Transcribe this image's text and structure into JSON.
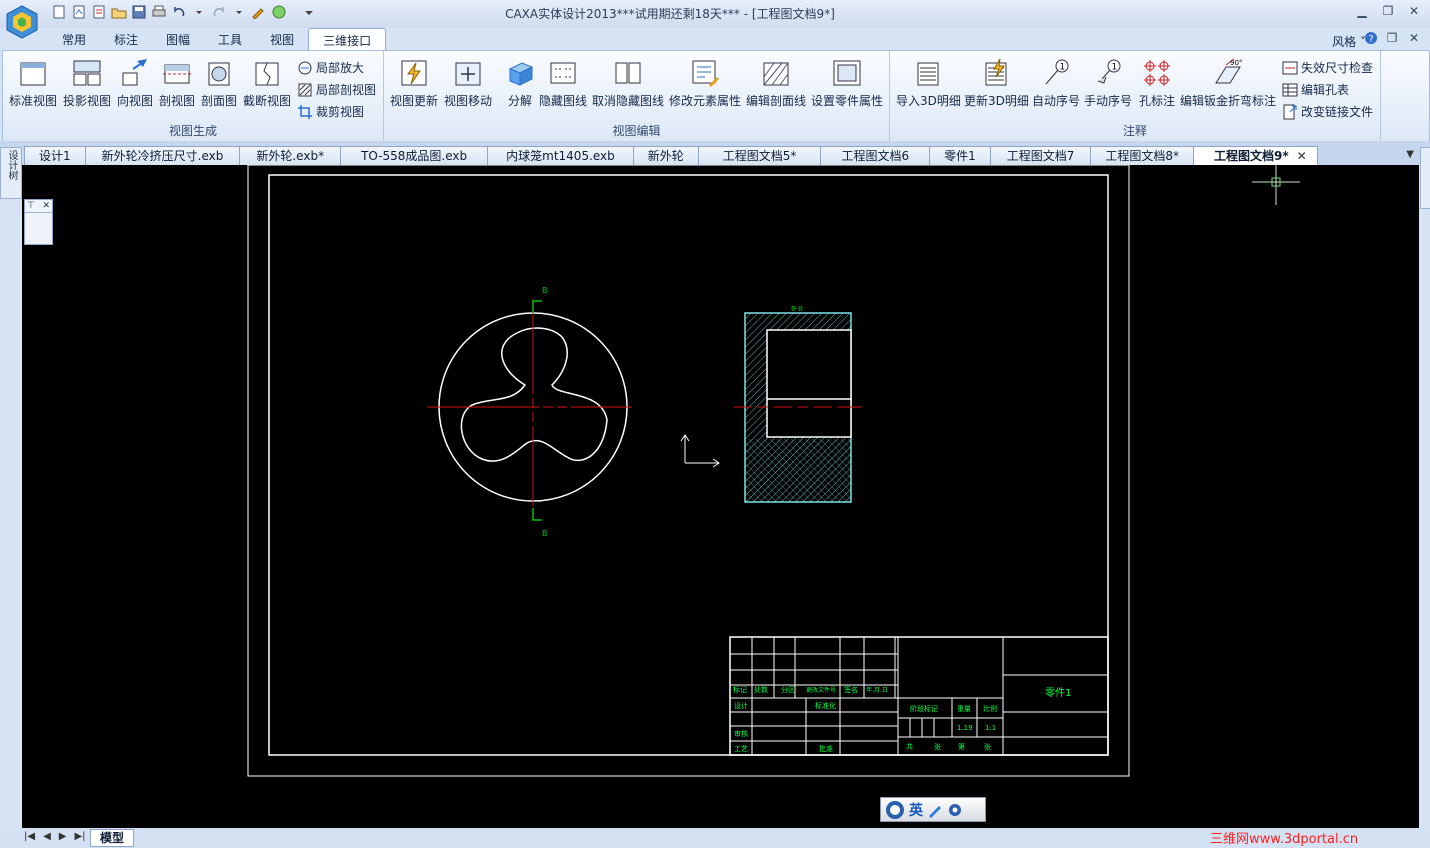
{
  "window": {
    "title": "CAXA实体设计2013***试用期还剩18天*** - [工程图文档9*]"
  },
  "ribbon_tabs": [
    {
      "label": "常用",
      "active": false
    },
    {
      "label": "标注",
      "active": false
    },
    {
      "label": "图幅",
      "active": false
    },
    {
      "label": "工具",
      "active": false
    },
    {
      "label": "视图",
      "active": false
    },
    {
      "label": "三维接口",
      "active": true
    }
  ],
  "style_menu": "风格",
  "groups": {
    "view_gen": {
      "label": "视图生成",
      "buttons": [
        "标准视图",
        "投影视图",
        "向视图",
        "剖视图",
        "剖面图",
        "截断视图"
      ],
      "small": [
        "局部放大",
        "局部剖视图",
        "裁剪视图"
      ]
    },
    "view_edit": {
      "label": "视图编辑",
      "buttons": [
        "视图更新",
        "视图移动",
        "分解",
        "隐藏图线",
        "取消隐藏图线",
        "修改元素属性",
        "编辑剖面线",
        "设置零件属性"
      ]
    },
    "annotate": {
      "label": "注释",
      "buttons": [
        "导入3D明细",
        "更新3D明细",
        "自动序号",
        "手动序号",
        "孔标注",
        "编辑钣金折弯标注"
      ],
      "small": [
        "失效尺寸检查",
        "编辑孔表",
        "改变链接文件"
      ]
    }
  },
  "doc_tabs": [
    {
      "label": "设计1",
      "active": false
    },
    {
      "label": "新外轮冷挤压尺寸.exb",
      "active": false
    },
    {
      "label": "新外轮.exb*",
      "active": false
    },
    {
      "label": "TO-558成品图.exb",
      "active": false
    },
    {
      "label": "内球笼mt1405.exb",
      "active": false
    },
    {
      "label": "新外轮",
      "active": false
    },
    {
      "label": "工程图文档5*",
      "active": false
    },
    {
      "label": "工程图文档6",
      "active": false
    },
    {
      "label": "零件1",
      "active": false
    },
    {
      "label": "工程图文档7",
      "active": false
    },
    {
      "label": "工程图文档8*",
      "active": false
    },
    {
      "label": "工程图文档9*",
      "active": true
    }
  ],
  "left_strip_label": "设计树",
  "drawing": {
    "section_mark_top": "B",
    "section_mark_bottom": "B",
    "section_title": "B-B",
    "part_name": "零件1",
    "title_block": {
      "row_labels": [
        "标记",
        "处数",
        "分区",
        "更改文件号",
        "签名",
        "年.月.日"
      ],
      "design": "设计",
      "standard": "标准化",
      "review": "审核",
      "process": "工艺",
      "approve": "批准",
      "stage_mark": "阶段标记",
      "weight": "重量",
      "scale": "比例",
      "weight_value": "1.19",
      "scale_value": "1:1",
      "sheet_total": "共",
      "sheet_count1": "张",
      "sheet_no": "第",
      "sheet_count2": "张"
    }
  },
  "ime": {
    "label": "英"
  },
  "bottom": {
    "model_tab": "模型"
  },
  "watermark": "三维网www.3dportal.cn",
  "colors": {
    "canvas": "#000000",
    "frame": "#ffffff",
    "center_line": "#d01010",
    "section_mark": "#00c000",
    "hatch": "#7de3e3",
    "title_text": "#00ff40"
  }
}
